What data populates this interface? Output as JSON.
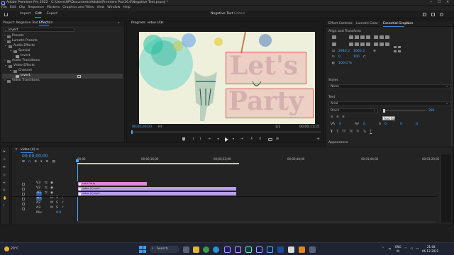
{
  "app": {
    "title": "Adobe Premiere Pro 2022 - C:\\Users\\HP\\Documents\\Adobe\\Premiere Pro\\16.0\\Negative Text.prproj *",
    "menu": [
      "File",
      "Edit",
      "Clip",
      "Sequence",
      "Markers",
      "Graphics and Titles",
      "View",
      "Window",
      "Help"
    ],
    "workspace_tabs": [
      "Import",
      "Edit",
      "Export"
    ],
    "active_workspace": "Edit",
    "project_title": "Negative Text",
    "edited_label": "- Edited"
  },
  "effects_panel": {
    "tabs": [
      "Project: Negative Text",
      "Effects"
    ],
    "search_value": "invert",
    "tree": [
      {
        "label": "Presets",
        "level": 1
      },
      {
        "label": "Lumetri Presets",
        "level": 1
      },
      {
        "label": "Audio Effects",
        "level": 1
      },
      {
        "label": "Special",
        "level": 2
      },
      {
        "label": "Invert",
        "level": 3
      },
      {
        "label": "Audio Transitions",
        "level": 1
      },
      {
        "label": "Video Effects",
        "level": 1
      },
      {
        "label": "Channel",
        "level": 2
      },
      {
        "label": "Invert",
        "level": 3,
        "selected": true
      },
      {
        "label": "Video Transitions",
        "level": 1
      }
    ]
  },
  "program_monitor": {
    "title": "Program: video (4)",
    "overlay_text": [
      "Let's",
      "Party"
    ],
    "timecode_left": "00;00;00;00",
    "fit": "Fit",
    "quality": "1/2",
    "timecode_right": "00;00;11;15"
  },
  "essential_graphics": {
    "tabs": [
      "Effect Controls",
      "Lumetri Color",
      "Essential Graphics"
    ],
    "active_tab": "Essential Graphics",
    "section_align": "Align and Transform",
    "pos_x": "2940.2",
    "pos_y": "1060.3",
    "rot_value": "0",
    "scale_value": "100",
    "opacity_value": "100.0 %",
    "styles_label": "Styles",
    "styles_value": "None",
    "text_label": "Text",
    "font_value": "Arial",
    "style_value": "Black",
    "font_size": "281",
    "tooltip": "Font Size",
    "kern_value": "0",
    "track_value": "0",
    "lead_value": "0",
    "baseline_value": "0",
    "tsume_value": "0",
    "appearance_label": "Appearance"
  },
  "timeline": {
    "tab": "video (4)",
    "timecode": "00;00;00;00",
    "ruler_labels": [
      "00;00",
      "00;00;16;00",
      "00;00;32;00",
      "00;00;48;00",
      "00;01;04;02",
      "00;01;20;02"
    ],
    "video_tracks": [
      "V3",
      "V2",
      "V1"
    ],
    "audio_tracks": [
      "A1",
      "A2",
      "A3"
    ],
    "mix_label": "Mix",
    "mix_value": "0.0",
    "clips": [
      {
        "label": "Let's Party",
        "track": "V3",
        "color": "#d88bd6"
      },
      {
        "label": "video (4).mp4",
        "track": "V2",
        "color": "#b79fea"
      },
      {
        "label": "video (4).mp4",
        "track": "V1",
        "color": "#b79fea"
      }
    ]
  },
  "taskbar": {
    "search_placeholder": "Search",
    "weather": "20°C",
    "lang_top": "ENG",
    "lang_bottom": "IN",
    "time": "21:04",
    "date": "06-12-2022"
  },
  "colors": {
    "accent": "#2d8ceb",
    "timecode": "#4da6ff",
    "clip_pink": "#d88bd6",
    "clip_purple": "#b79fea",
    "overlay_box": "#e25555"
  }
}
